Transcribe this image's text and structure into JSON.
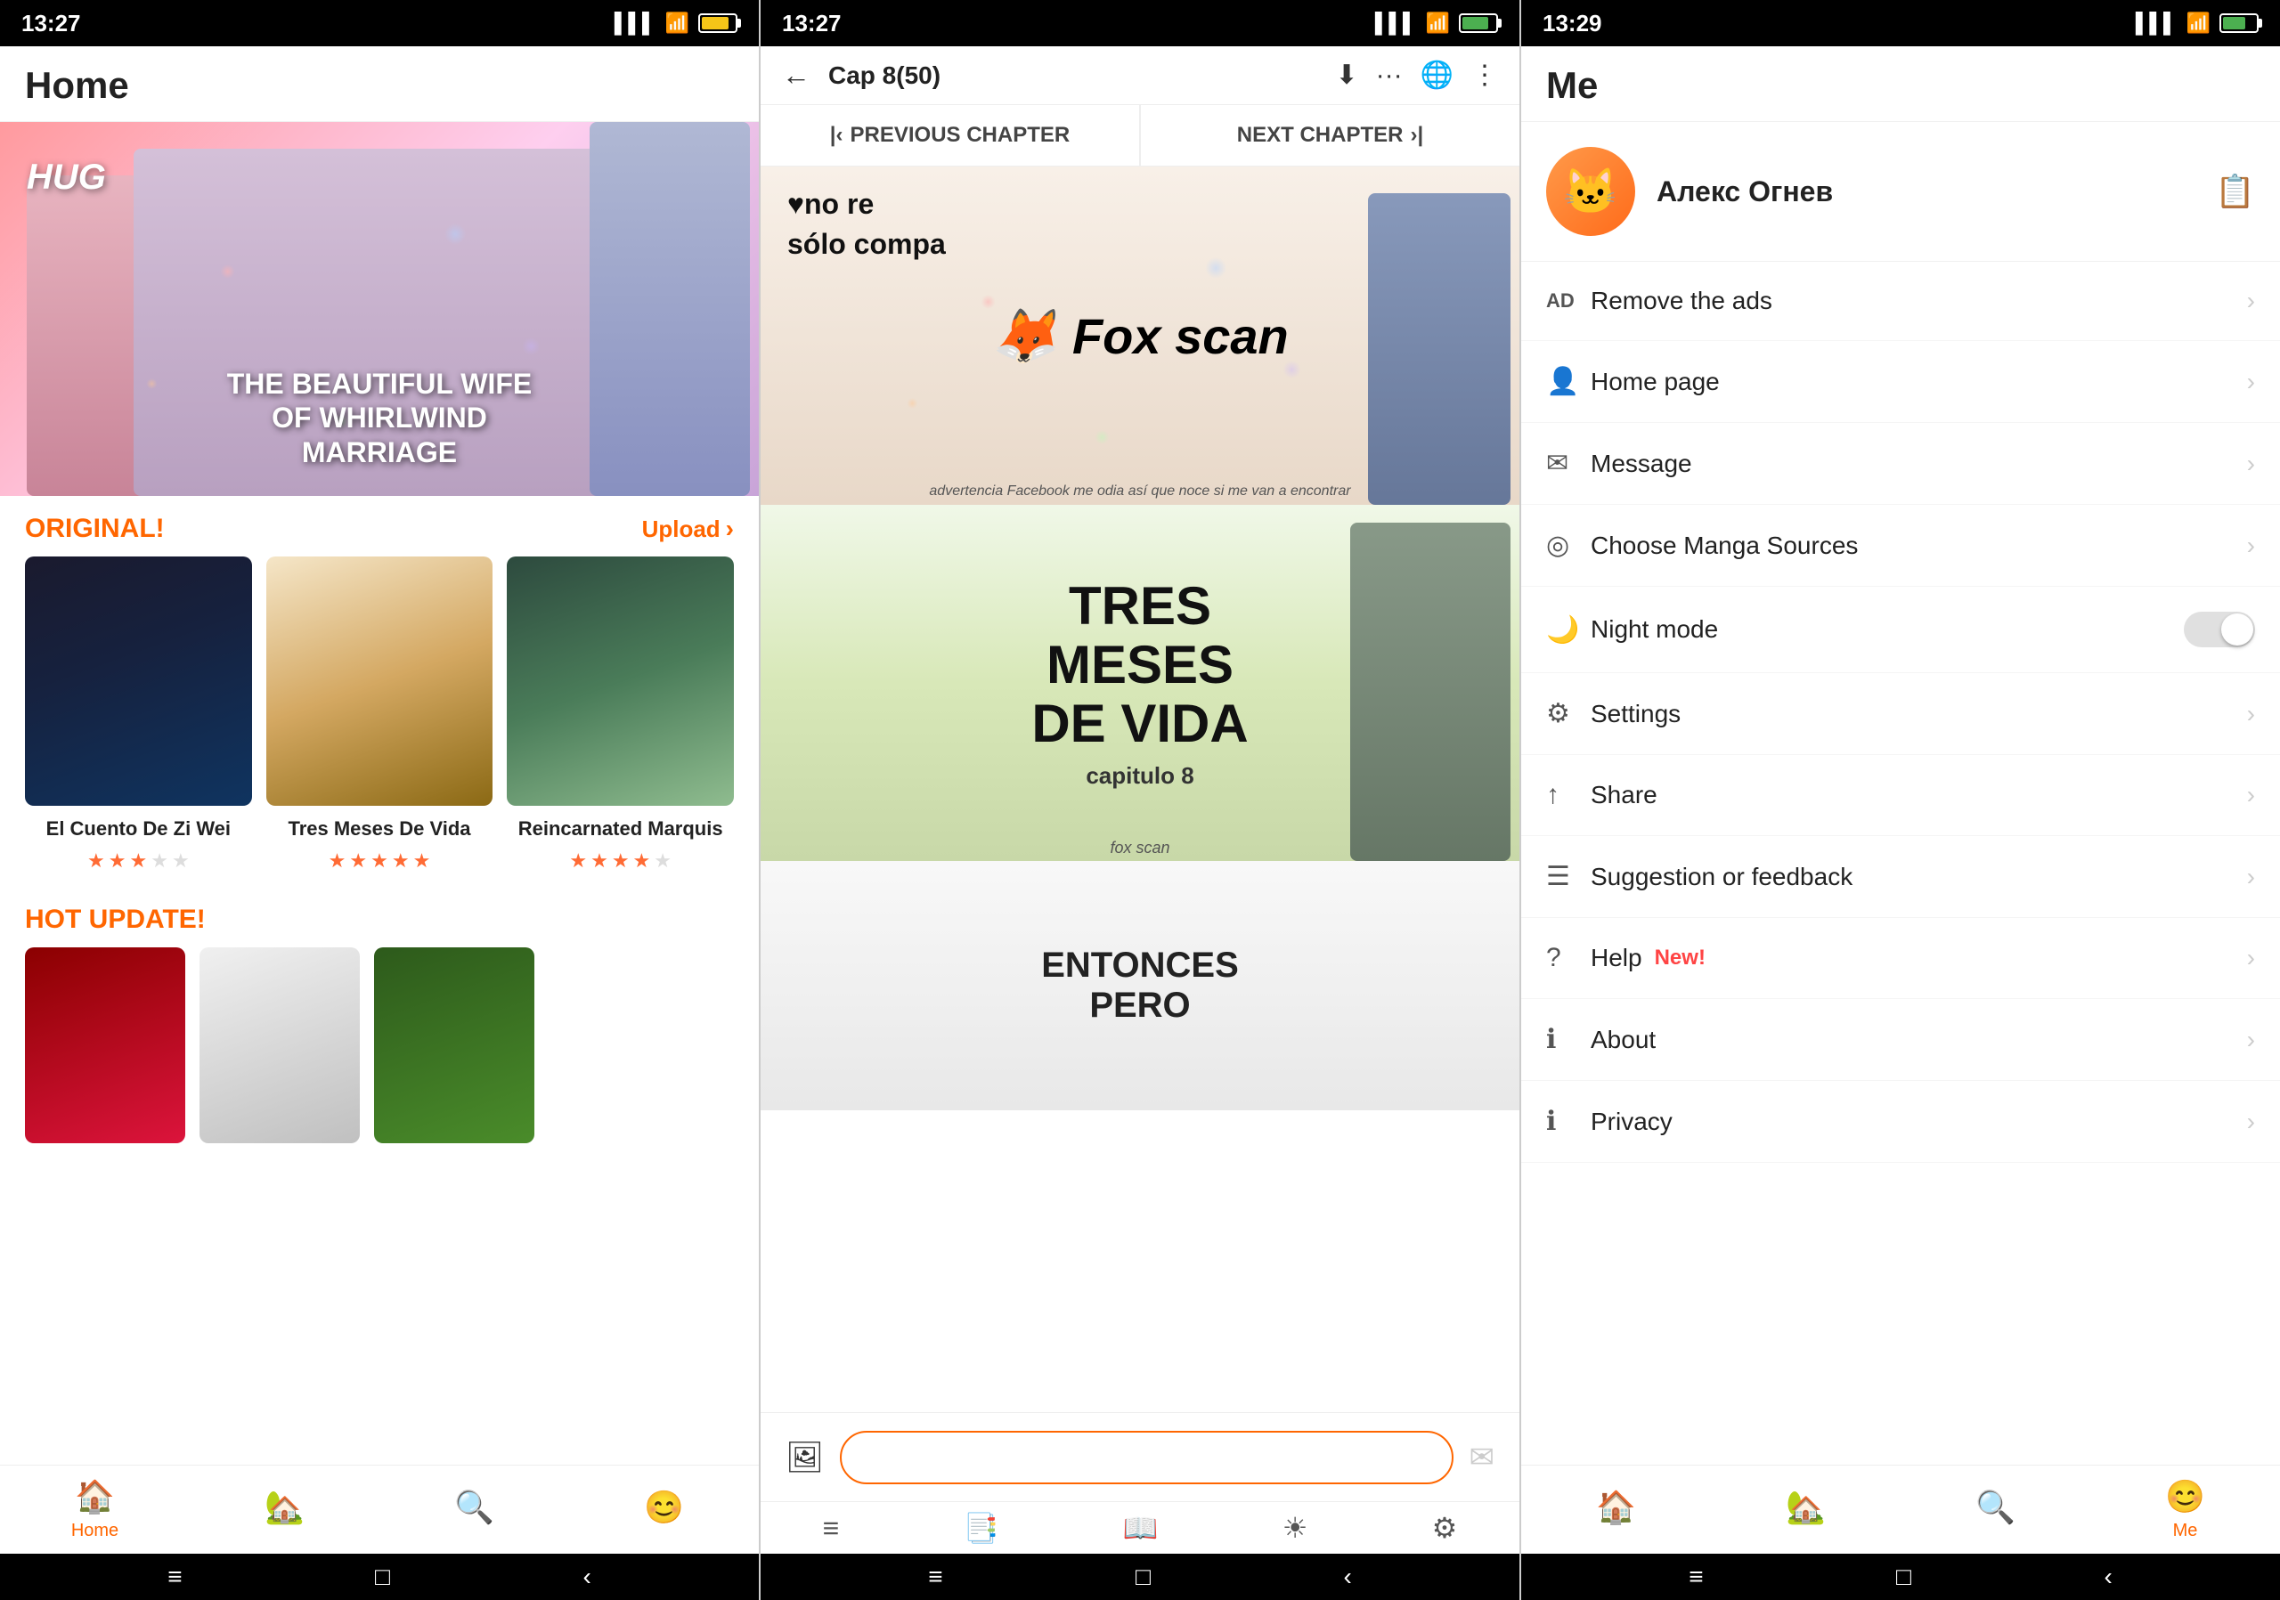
{
  "phone1": {
    "statusBar": {
      "time": "13:27",
      "batteryIcon": "🔋",
      "batteryLevel": 84,
      "signalBars": "📶"
    },
    "header": {
      "title": "Home"
    },
    "heroBanner": {
      "label": "HUG",
      "title": "THE BEAUTIFUL WIFE\nOF WHIRLWIND\nMARRIAGE"
    },
    "originalSection": {
      "title": "ORIGINAL!",
      "uploadLabel": "Upload",
      "chevron": "›"
    },
    "mangaCards": [
      {
        "title": "El Cuento De Zi Wei",
        "stars": [
          true,
          true,
          true,
          false,
          false
        ]
      },
      {
        "title": "Tres Meses De Vida",
        "stars": [
          true,
          true,
          true,
          true,
          true
        ]
      },
      {
        "title": "Reincarnated Marquis",
        "stars": [
          true,
          true,
          true,
          true,
          false
        ]
      }
    ],
    "hotSection": {
      "title": "HOT UPDATE!"
    },
    "bottomNav": [
      {
        "icon": "🏠",
        "label": "Home",
        "active": true
      },
      {
        "icon": "🏠",
        "label": "",
        "active": false
      },
      {
        "icon": "🔍",
        "label": "",
        "active": false
      },
      {
        "icon": "😊",
        "label": "",
        "active": false
      }
    ],
    "navButtons": [
      "≡",
      "□",
      "‹"
    ]
  },
  "phone2": {
    "statusBar": {
      "time": "13:27",
      "batteryIcon": "🔋"
    },
    "readerHeader": {
      "backLabel": "←",
      "title": "Cap 8(50)",
      "actions": [
        "⬇",
        "···",
        "🌐",
        "⋮"
      ]
    },
    "chapterNav": {
      "previous": "PREVIOUS CHAPTER",
      "next": "NEXT CHAPTER"
    },
    "pages": [
      {
        "type": "fox-scan",
        "textOverlay": "♥no re\nsólo compa",
        "brandName": "Fox scan",
        "advertText": "advertencia Facebook me odia así que noce si me van a encontrar"
      },
      {
        "type": "tres-meses",
        "title": "TRES\nMESES\nDE VIDA",
        "capitulo": "capitulo 8",
        "foxScanLabel": "fox scan"
      },
      {
        "type": "entonces",
        "text": "ENTONCES\nPERO"
      }
    ],
    "commentPlaceholder": "",
    "navButtons": [
      "≡",
      "≡≡",
      "☰",
      "☀",
      "⚙"
    ]
  },
  "phone3": {
    "statusBar": {
      "time": "13:29",
      "batteryIcon": "🔋"
    },
    "header": {
      "title": "Me"
    },
    "profile": {
      "name": "Алекс Огнев",
      "avatar": "🐱",
      "editIcon": "📋"
    },
    "menuItems": [
      {
        "icon": "AD",
        "label": "Remove the ads",
        "type": "arrow",
        "badge": ""
      },
      {
        "icon": "👤",
        "label": "Home page",
        "type": "arrow",
        "badge": ""
      },
      {
        "icon": "✉",
        "label": "Message",
        "type": "arrow",
        "badge": ""
      },
      {
        "icon": "◎",
        "label": "Choose Manga Sources",
        "type": "arrow",
        "badge": ""
      },
      {
        "icon": "🌙",
        "label": "Night mode",
        "type": "toggle",
        "badge": ""
      },
      {
        "icon": "⚙",
        "label": "Settings",
        "type": "arrow",
        "badge": ""
      },
      {
        "icon": "↑",
        "label": "Share",
        "type": "arrow",
        "badge": ""
      },
      {
        "icon": "☰",
        "label": "Suggestion or feedback",
        "type": "arrow",
        "badge": ""
      },
      {
        "icon": "?",
        "label": "Help",
        "type": "arrow",
        "badge": "New!"
      },
      {
        "icon": "ℹ",
        "label": "About",
        "type": "arrow",
        "badge": ""
      },
      {
        "icon": "ℹ",
        "label": "Privacy",
        "type": "arrow",
        "badge": ""
      }
    ],
    "bottomNav": [
      {
        "icon": "🏠",
        "label": "",
        "active": false
      },
      {
        "icon": "🏠",
        "label": "",
        "active": false
      },
      {
        "icon": "🔍",
        "label": "",
        "active": false
      },
      {
        "icon": "😊",
        "label": "Me",
        "active": true
      }
    ],
    "navButtons": [
      "≡",
      "□",
      "‹"
    ]
  }
}
